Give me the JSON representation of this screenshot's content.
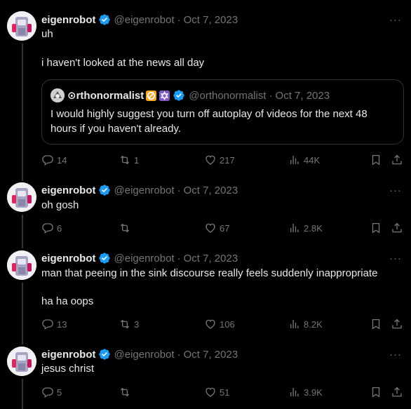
{
  "tweets": [
    {
      "name": "eigenrobot",
      "handle": "@eigenrobot",
      "dot": "·",
      "date": "Oct 7, 2023",
      "more": "···",
      "lines": [
        "uh",
        "i haven't looked at the news all day"
      ],
      "quote": {
        "name": "⊙rthonormalist",
        "handle": "@orthonormalist",
        "dot": "·",
        "date": "Oct 7, 2023",
        "text": "I would highly suggest you turn off autoplay of videos for the next 48 hours if you haven't already."
      },
      "stats": {
        "replies": "14",
        "retweets": "1",
        "likes": "217",
        "views": "44K"
      }
    },
    {
      "name": "eigenrobot",
      "handle": "@eigenrobot",
      "dot": "·",
      "date": "Oct 7, 2023",
      "more": "···",
      "lines": [
        "oh gosh"
      ],
      "stats": {
        "replies": "6",
        "retweets": "",
        "likes": "67",
        "views": "2.8K"
      }
    },
    {
      "name": "eigenrobot",
      "handle": "@eigenrobot",
      "dot": "·",
      "date": "Oct 7, 2023",
      "more": "···",
      "lines": [
        "man that peeing in the sink discourse really feels suddenly inappropriate",
        "ha ha oops"
      ],
      "stats": {
        "replies": "13",
        "retweets": "3",
        "likes": "106",
        "views": "8.2K"
      }
    },
    {
      "name": "eigenrobot",
      "handle": "@eigenrobot",
      "dot": "·",
      "date": "Oct 7, 2023",
      "more": "···",
      "lines": [
        "jesus christ"
      ],
      "stats": {
        "replies": "5",
        "retweets": "",
        "likes": "51",
        "views": "3.9K"
      }
    }
  ],
  "icons": {
    "reply": "reply-icon",
    "retweet": "retweet-icon",
    "like": "heart-icon",
    "views": "views-icon",
    "bookmark": "bookmark-icon",
    "share": "share-icon",
    "verified": "verified-badge-icon"
  },
  "colors": {
    "background": "#000000",
    "text": "#e7e9ea",
    "muted": "#71767b",
    "verified": "#1d9bf0",
    "border": "#2f3336"
  }
}
